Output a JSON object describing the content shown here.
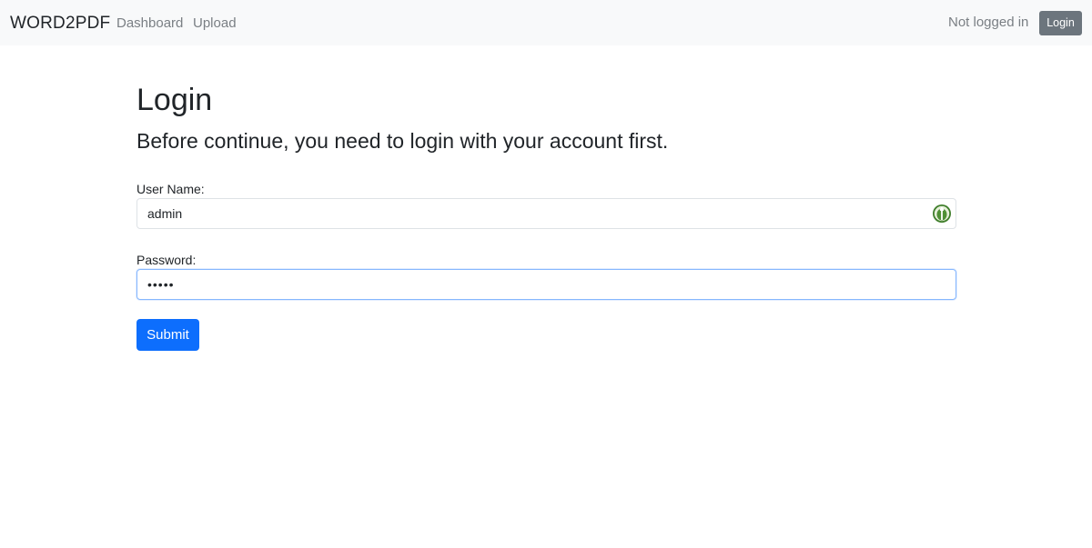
{
  "navbar": {
    "brand": "WORD2PDF",
    "links": [
      "Dashboard",
      "Upload"
    ],
    "status": "Not logged in",
    "login_label": "Login"
  },
  "main": {
    "title": "Login",
    "subtitle": "Before continue, you need to login with your account first.",
    "username_label": "User Name:",
    "username_value": "admin",
    "password_label": "Password:",
    "password_value": "•••••",
    "submit_label": "Submit"
  },
  "icons": {
    "username_field_icon": "password-manager-icon"
  },
  "colors": {
    "navbar_bg": "#f8f9fa",
    "primary": "#0d6efd",
    "secondary": "#6c757d",
    "focus_border": "#86b7fe",
    "extension_green": "#3f7e2b"
  }
}
